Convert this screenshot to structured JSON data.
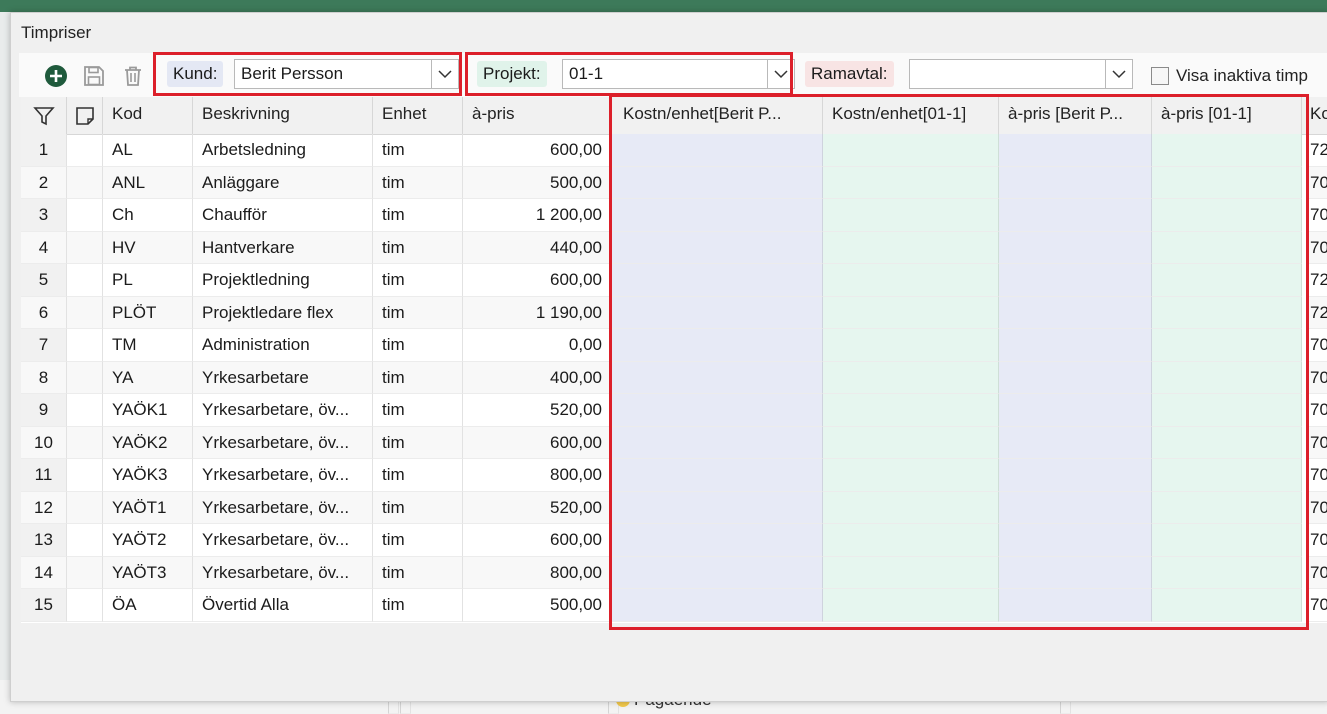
{
  "window": {
    "title": "Timpriser"
  },
  "toolbar": {
    "icons": [
      "add-icon",
      "save-icon",
      "delete-icon"
    ],
    "kund_label": "Kund:",
    "kund_value": "Berit Persson",
    "projekt_label": "Projekt:",
    "projekt_value": "01-1",
    "ramavtal_label": "Ramavtal:",
    "ramavtal_value": "",
    "visa_inaktiva_label": "Visa inaktiva timp"
  },
  "colors": {
    "highlight": "#dc1f2a",
    "kund_label_bg": "#e4e8f4",
    "projekt_label_bg": "#e0f3ea",
    "ramavtal_label_bg": "#f8e4e4",
    "kund_col_bg": "#e7eaf6",
    "projekt_col_bg": "#e6f6ef"
  },
  "grid": {
    "columns": [
      "Kod",
      "Beskrivning",
      "Enhet",
      "à-pris",
      "Kostn/enhet[Berit P...",
      "Kostn/enhet[01-1]",
      "à-pris [Berit P...",
      "à-pris [01-1]",
      "Ko"
    ],
    "rows": [
      {
        "n": "1",
        "kod": "AL",
        "besk": "Arbetsledning",
        "enhet": "tim",
        "pris": "600,00",
        "extra": "72"
      },
      {
        "n": "2",
        "kod": "ANL",
        "besk": "Anläggare",
        "enhet": "tim",
        "pris": "500,00",
        "extra": "70"
      },
      {
        "n": "3",
        "kod": "Ch",
        "besk": "Chaufför",
        "enhet": "tim",
        "pris": "1 200,00",
        "extra": "70"
      },
      {
        "n": "4",
        "kod": "HV",
        "besk": "Hantverkare",
        "enhet": "tim",
        "pris": "440,00",
        "extra": "70"
      },
      {
        "n": "5",
        "kod": "PL",
        "besk": "Projektledning",
        "enhet": "tim",
        "pris": "600,00",
        "extra": "72"
      },
      {
        "n": "6",
        "kod": "PLÖT",
        "besk": "Projektledare flex",
        "enhet": "tim",
        "pris": "1 190,00",
        "extra": "72"
      },
      {
        "n": "7",
        "kod": "TM",
        "besk": "Administration",
        "enhet": "tim",
        "pris": "0,00",
        "extra": "70"
      },
      {
        "n": "8",
        "kod": "YA",
        "besk": "Yrkesarbetare",
        "enhet": "tim",
        "pris": "400,00",
        "extra": "70"
      },
      {
        "n": "9",
        "kod": "YAÖK1",
        "besk": "Yrkesarbetare, öv...",
        "enhet": "tim",
        "pris": "520,00",
        "extra": "70"
      },
      {
        "n": "10",
        "kod": "YAÖK2",
        "besk": "Yrkesarbetare, öv...",
        "enhet": "tim",
        "pris": "600,00",
        "extra": "70"
      },
      {
        "n": "11",
        "kod": "YAÖK3",
        "besk": "Yrkesarbetare, öv...",
        "enhet": "tim",
        "pris": "800,00",
        "extra": "70"
      },
      {
        "n": "12",
        "kod": "YAÖT1",
        "besk": "Yrkesarbetare, öv...",
        "enhet": "tim",
        "pris": "520,00",
        "extra": "70"
      },
      {
        "n": "13",
        "kod": "YAÖT2",
        "besk": "Yrkesarbetare, öv...",
        "enhet": "tim",
        "pris": "600,00",
        "extra": "70"
      },
      {
        "n": "14",
        "kod": "YAÖT3",
        "besk": "Yrkesarbetare, öv...",
        "enhet": "tim",
        "pris": "800,00",
        "extra": "70"
      },
      {
        "n": "15",
        "kod": "ÖA",
        "besk": "Övertid Alla",
        "enhet": "tim",
        "pris": "500,00",
        "extra": "70"
      }
    ]
  },
  "background": {
    "status_text": "Pågående"
  }
}
